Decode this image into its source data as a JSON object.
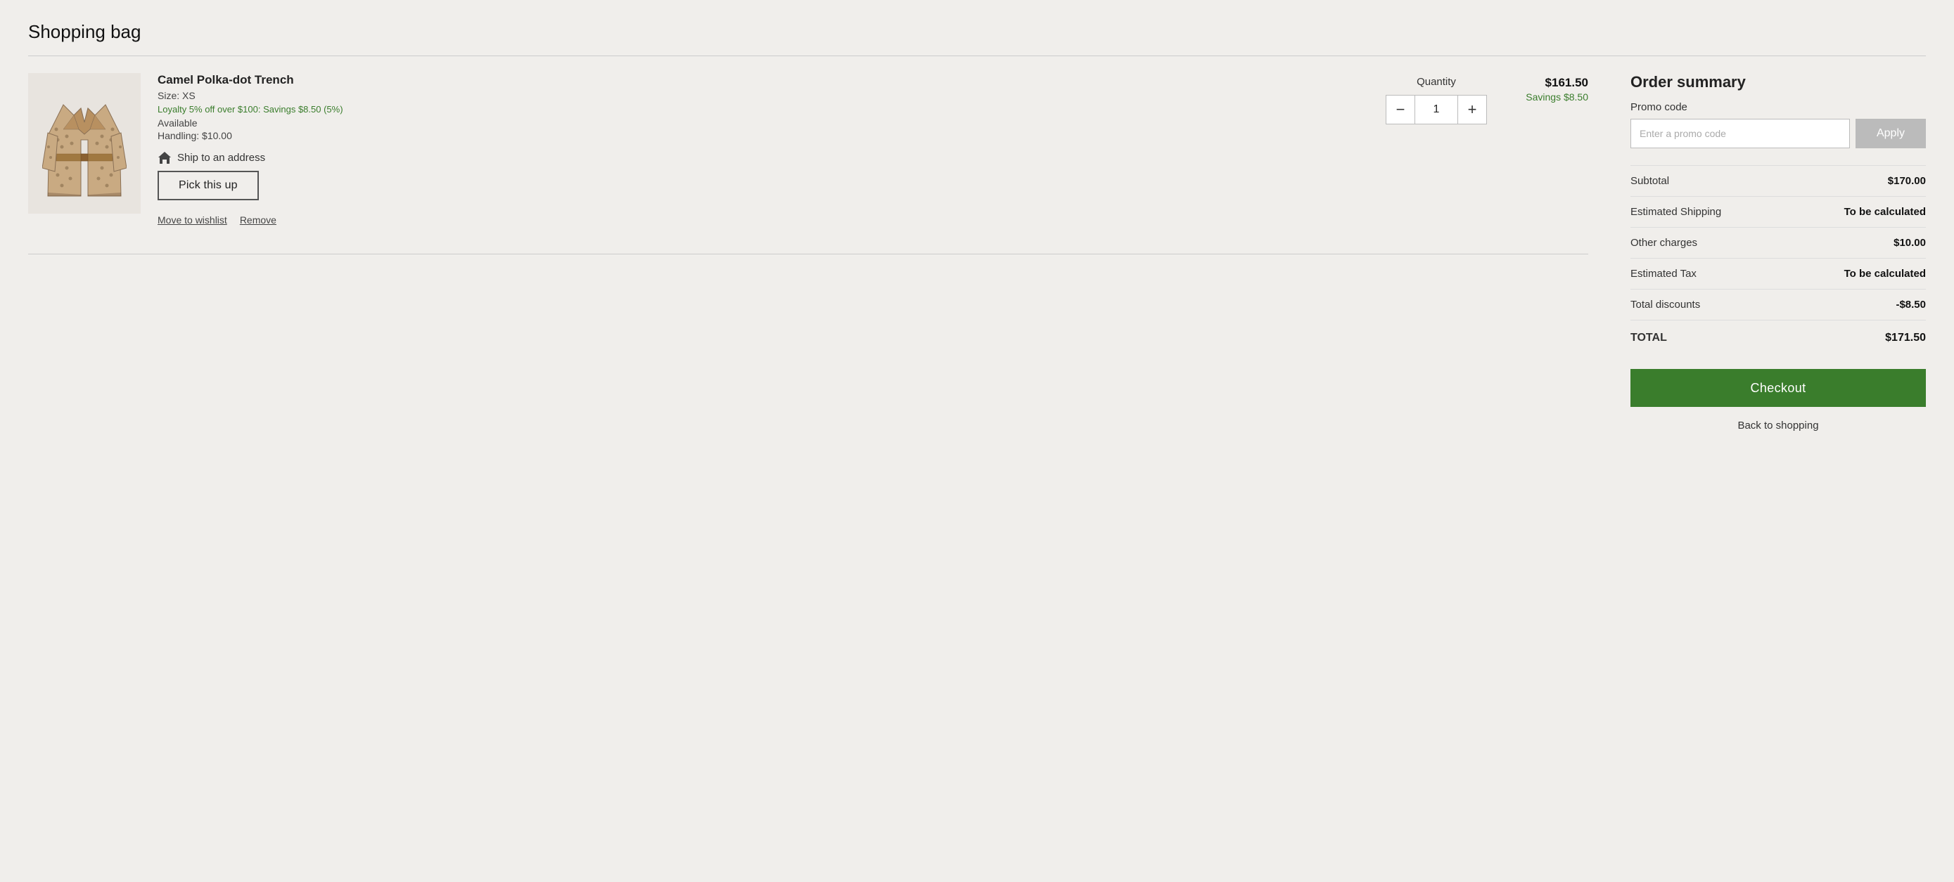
{
  "page": {
    "title": "Shopping bag"
  },
  "cart": {
    "items": [
      {
        "name": "Camel Polka-dot Trench",
        "size": "Size: XS",
        "loyalty": "Loyalty 5% off over $100: Savings $8.50 (5%)",
        "availability": "Available",
        "handling": "Handling: $10.00",
        "ship_label": "Ship to an address",
        "pickup_label": "Pick this up",
        "quantity": 1,
        "price": "$161.50",
        "savings": "Savings $8.50",
        "move_to_wishlist": "Move to wishlist",
        "remove": "Remove"
      }
    ],
    "quantity_label": "Quantity",
    "minus_label": "−",
    "plus_label": "+"
  },
  "order_summary": {
    "title": "Order summary",
    "promo_label": "Promo code",
    "promo_placeholder": "Enter a promo code",
    "apply_label": "Apply",
    "rows": [
      {
        "label": "Subtotal",
        "value": "$170.00",
        "bold": true,
        "type": "normal"
      },
      {
        "label": "Estimated Shipping",
        "value": "To be calculated",
        "bold": true,
        "type": "normal"
      },
      {
        "label": "Other charges",
        "value": "$10.00",
        "bold": true,
        "type": "normal"
      },
      {
        "label": "Estimated Tax",
        "value": "To be calculated",
        "bold": true,
        "type": "normal"
      },
      {
        "label": "Total discounts",
        "value": "-$8.50",
        "bold": true,
        "type": "normal"
      }
    ],
    "total_label": "TOTAL",
    "total_value": "$171.50",
    "checkout_label": "Checkout",
    "back_label": "Back to shopping"
  },
  "icons": {
    "ship": "🏠",
    "minus": "−",
    "plus": "+"
  }
}
